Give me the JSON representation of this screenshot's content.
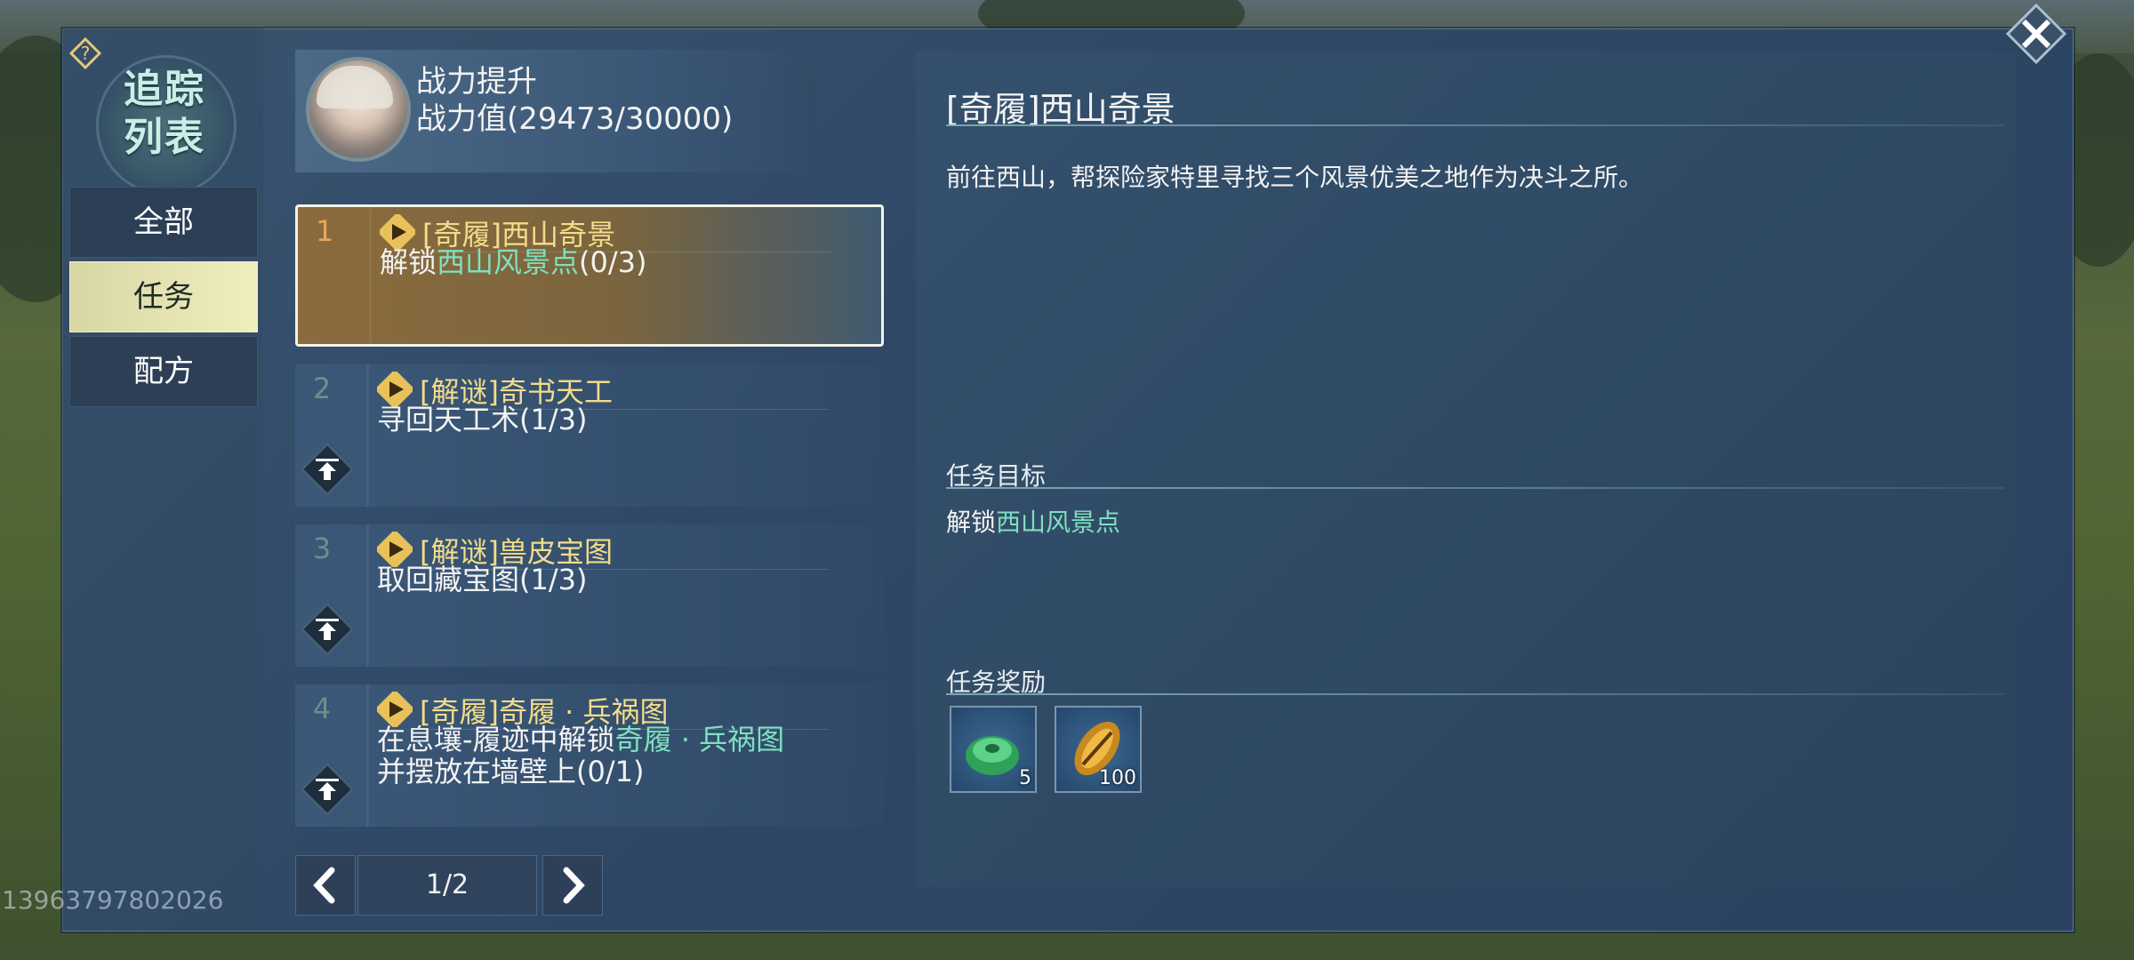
{
  "sidebar": {
    "title": "追踪列表",
    "tabs": [
      {
        "label": "全部",
        "active": false
      },
      {
        "label": "任务",
        "active": true
      },
      {
        "label": "配方",
        "active": false
      }
    ]
  },
  "profile": {
    "title": "战力提升",
    "power": "战力值(29473/30000)"
  },
  "quests": [
    {
      "num": "1",
      "title": "[奇履]西山奇景",
      "desc_prefix": "解锁",
      "desc_highlight": "西山风景点",
      "desc_suffix": "(0/3)",
      "selected": true
    },
    {
      "num": "2",
      "title": "[解谜]奇书天工",
      "desc_prefix": "寻回天工术(1/3)",
      "desc_highlight": "",
      "desc_suffix": "",
      "selected": false
    },
    {
      "num": "3",
      "title": "[解谜]兽皮宝图",
      "desc_prefix": "取回藏宝图(1/3)",
      "desc_highlight": "",
      "desc_suffix": "",
      "selected": false
    },
    {
      "num": "4",
      "title": "[奇履]奇履 · 兵祸图",
      "desc_prefix": "在息壤-履迹中解锁",
      "desc_highlight": "奇履 · 兵祸图",
      "desc_suffix": "并摆放在墙壁上(0/1)",
      "selected": false
    }
  ],
  "pager": {
    "text": "1/2"
  },
  "detail": {
    "title": "[奇履]西山奇景",
    "description": "前往西山，帮探险家特里寻找三个风景优美之地作为决斗之所。",
    "objective_heading": "任务目标",
    "objective_prefix": "解锁",
    "objective_highlight": "西山风景点",
    "reward_heading": "任务奖励",
    "rewards": [
      {
        "icon": "jade-icon",
        "count": "5"
      },
      {
        "icon": "shell-icon",
        "count": "100"
      }
    ]
  },
  "uid": "13963797802026",
  "colors": {
    "highlight": "#7fe0bf",
    "quest_title": "#f3dc8a",
    "active_tab": "#efeebd"
  }
}
